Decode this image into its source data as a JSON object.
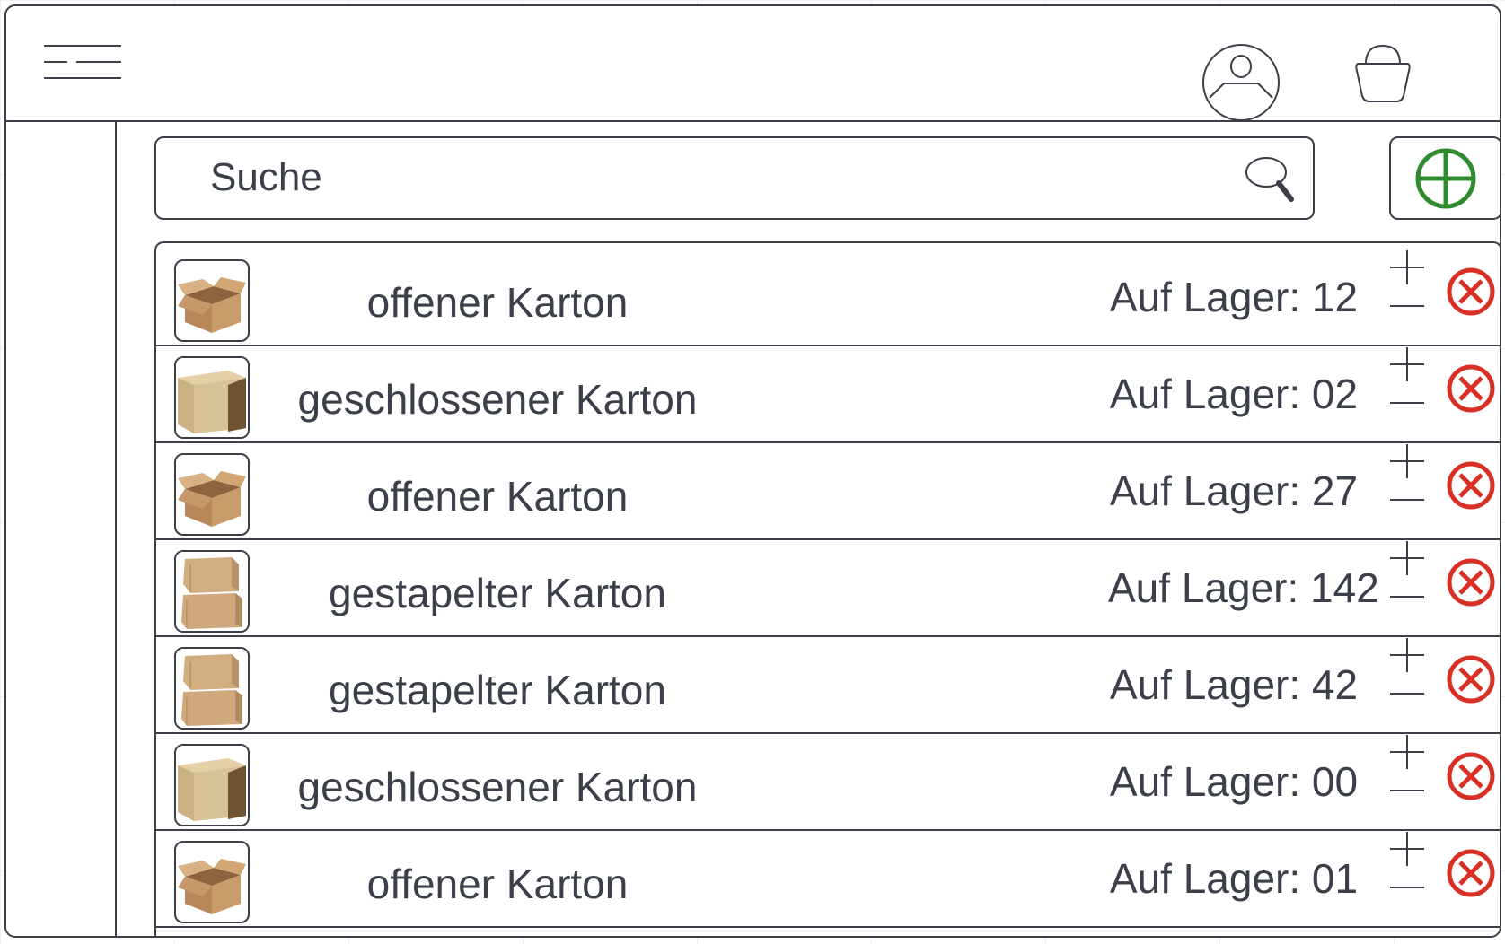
{
  "header": {
    "menu_icon": "hamburger-menu-icon",
    "profile_icon": "user-profile-icon",
    "basket_icon": "basket-icon"
  },
  "search": {
    "placeholder": "Suche",
    "icon": "magnifier-icon"
  },
  "add_button": {
    "icon": "add-circle-icon",
    "color": "#2e8b2e"
  },
  "items": [
    {
      "image": "open-box",
      "name": "offener Karton",
      "stock": "Auf Lager: 12"
    },
    {
      "image": "closed-box",
      "name": "geschlossener Karton",
      "stock": "Auf Lager: 02"
    },
    {
      "image": "open-box",
      "name": "offener Karton",
      "stock": "Auf Lager: 27"
    },
    {
      "image": "stacked-boxes",
      "name": "gestapelter Karton",
      "stock": "Auf Lager: 142"
    },
    {
      "image": "stacked-boxes",
      "name": "gestapelter Karton",
      "stock": "Auf Lager: 42"
    },
    {
      "image": "closed-box",
      "name": "geschlossener Karton",
      "stock": "Auf Lager: 00"
    },
    {
      "image": "open-box",
      "name": "offener Karton",
      "stock": "Auf Lager: 01"
    }
  ],
  "colors": {
    "delete": "#d93025",
    "add": "#2e8b2e",
    "line": "#3c3f47"
  }
}
